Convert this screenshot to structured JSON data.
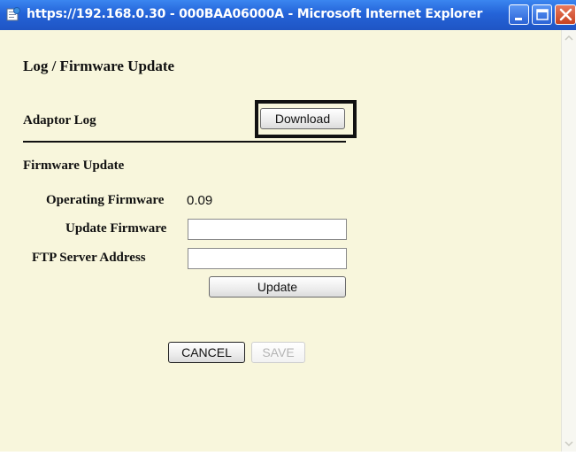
{
  "window": {
    "title": "https://192.168.0.30 - 000BAA06000A - Microsoft Internet Explorer",
    "icon": "ie-page-icon",
    "controls": [
      "minimize-icon",
      "maximize-icon",
      "close-icon"
    ]
  },
  "page": {
    "heading": "Log / Firmware Update",
    "adaptor_log": {
      "label": "Adaptor Log",
      "download_label": "Download"
    },
    "firmware": {
      "section_title": "Firmware Update",
      "operating_label": "Operating Firmware",
      "operating_value": "0.09",
      "update_label": "Update Firmware",
      "update_value": "",
      "ftp_label": "FTP Server Address",
      "ftp_value": "",
      "update_button": "Update"
    },
    "actions": {
      "cancel_label": "CANCEL",
      "save_label": "SAVE"
    }
  },
  "colors": {
    "background": "#f8f6dc",
    "titlebar": "#2463d8",
    "close_button": "#c8421f"
  }
}
